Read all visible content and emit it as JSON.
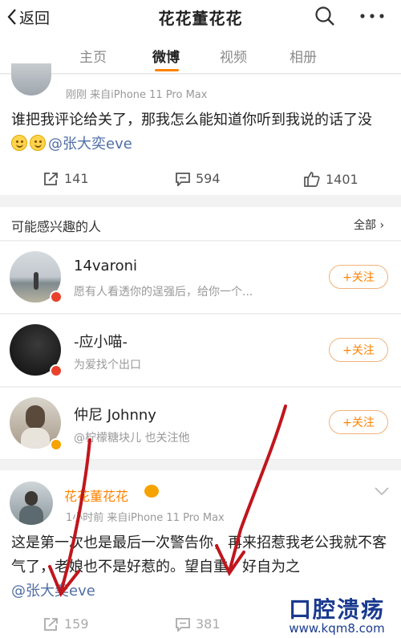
{
  "header": {
    "back_label": "返回",
    "title": "花花董花花",
    "icons": [
      "search-icon",
      "more-icon"
    ]
  },
  "tabs": [
    {
      "label": "主页",
      "active": false
    },
    {
      "label": "微博",
      "active": true
    },
    {
      "label": "视频",
      "active": false
    },
    {
      "label": "相册",
      "active": false
    }
  ],
  "accent_color": "#ff8200",
  "post1": {
    "meta": "刚刚  来自iPhone 11 Pro Max",
    "text": "谁把我评论给关了，那我怎么能知道你听到我说的话了没",
    "mention": "@张大奕eve",
    "reposts": "141",
    "comments": "594",
    "likes": "1401"
  },
  "suggestions": {
    "title": "可能感兴趣的人",
    "all_label": "全部 ›",
    "people": [
      {
        "name": "14varoni",
        "desc": "愿有人看透你的逞强后，给你一个...",
        "follow": "+关注"
      },
      {
        "name": "-应小喵-",
        "desc": "为爱找个出口",
        "follow": "+关注"
      },
      {
        "name": "仲尼 Johnny",
        "desc": "@柠檬糖块儿 也关注他",
        "follow": "+关注"
      }
    ]
  },
  "post2": {
    "name": "花花董花花",
    "meta": "1小时前  来自iPhone 11 Pro Max",
    "text": "这是第一次也是最后一次警告你，再来招惹我老公我就不客气了，老娘也不是好惹的。望自重，好自为之",
    "mention": "@张大奕eve",
    "reposts": "159",
    "comments": "381"
  },
  "watermark": {
    "title": "口腔溃疡",
    "url": "www.kqm8.com"
  }
}
